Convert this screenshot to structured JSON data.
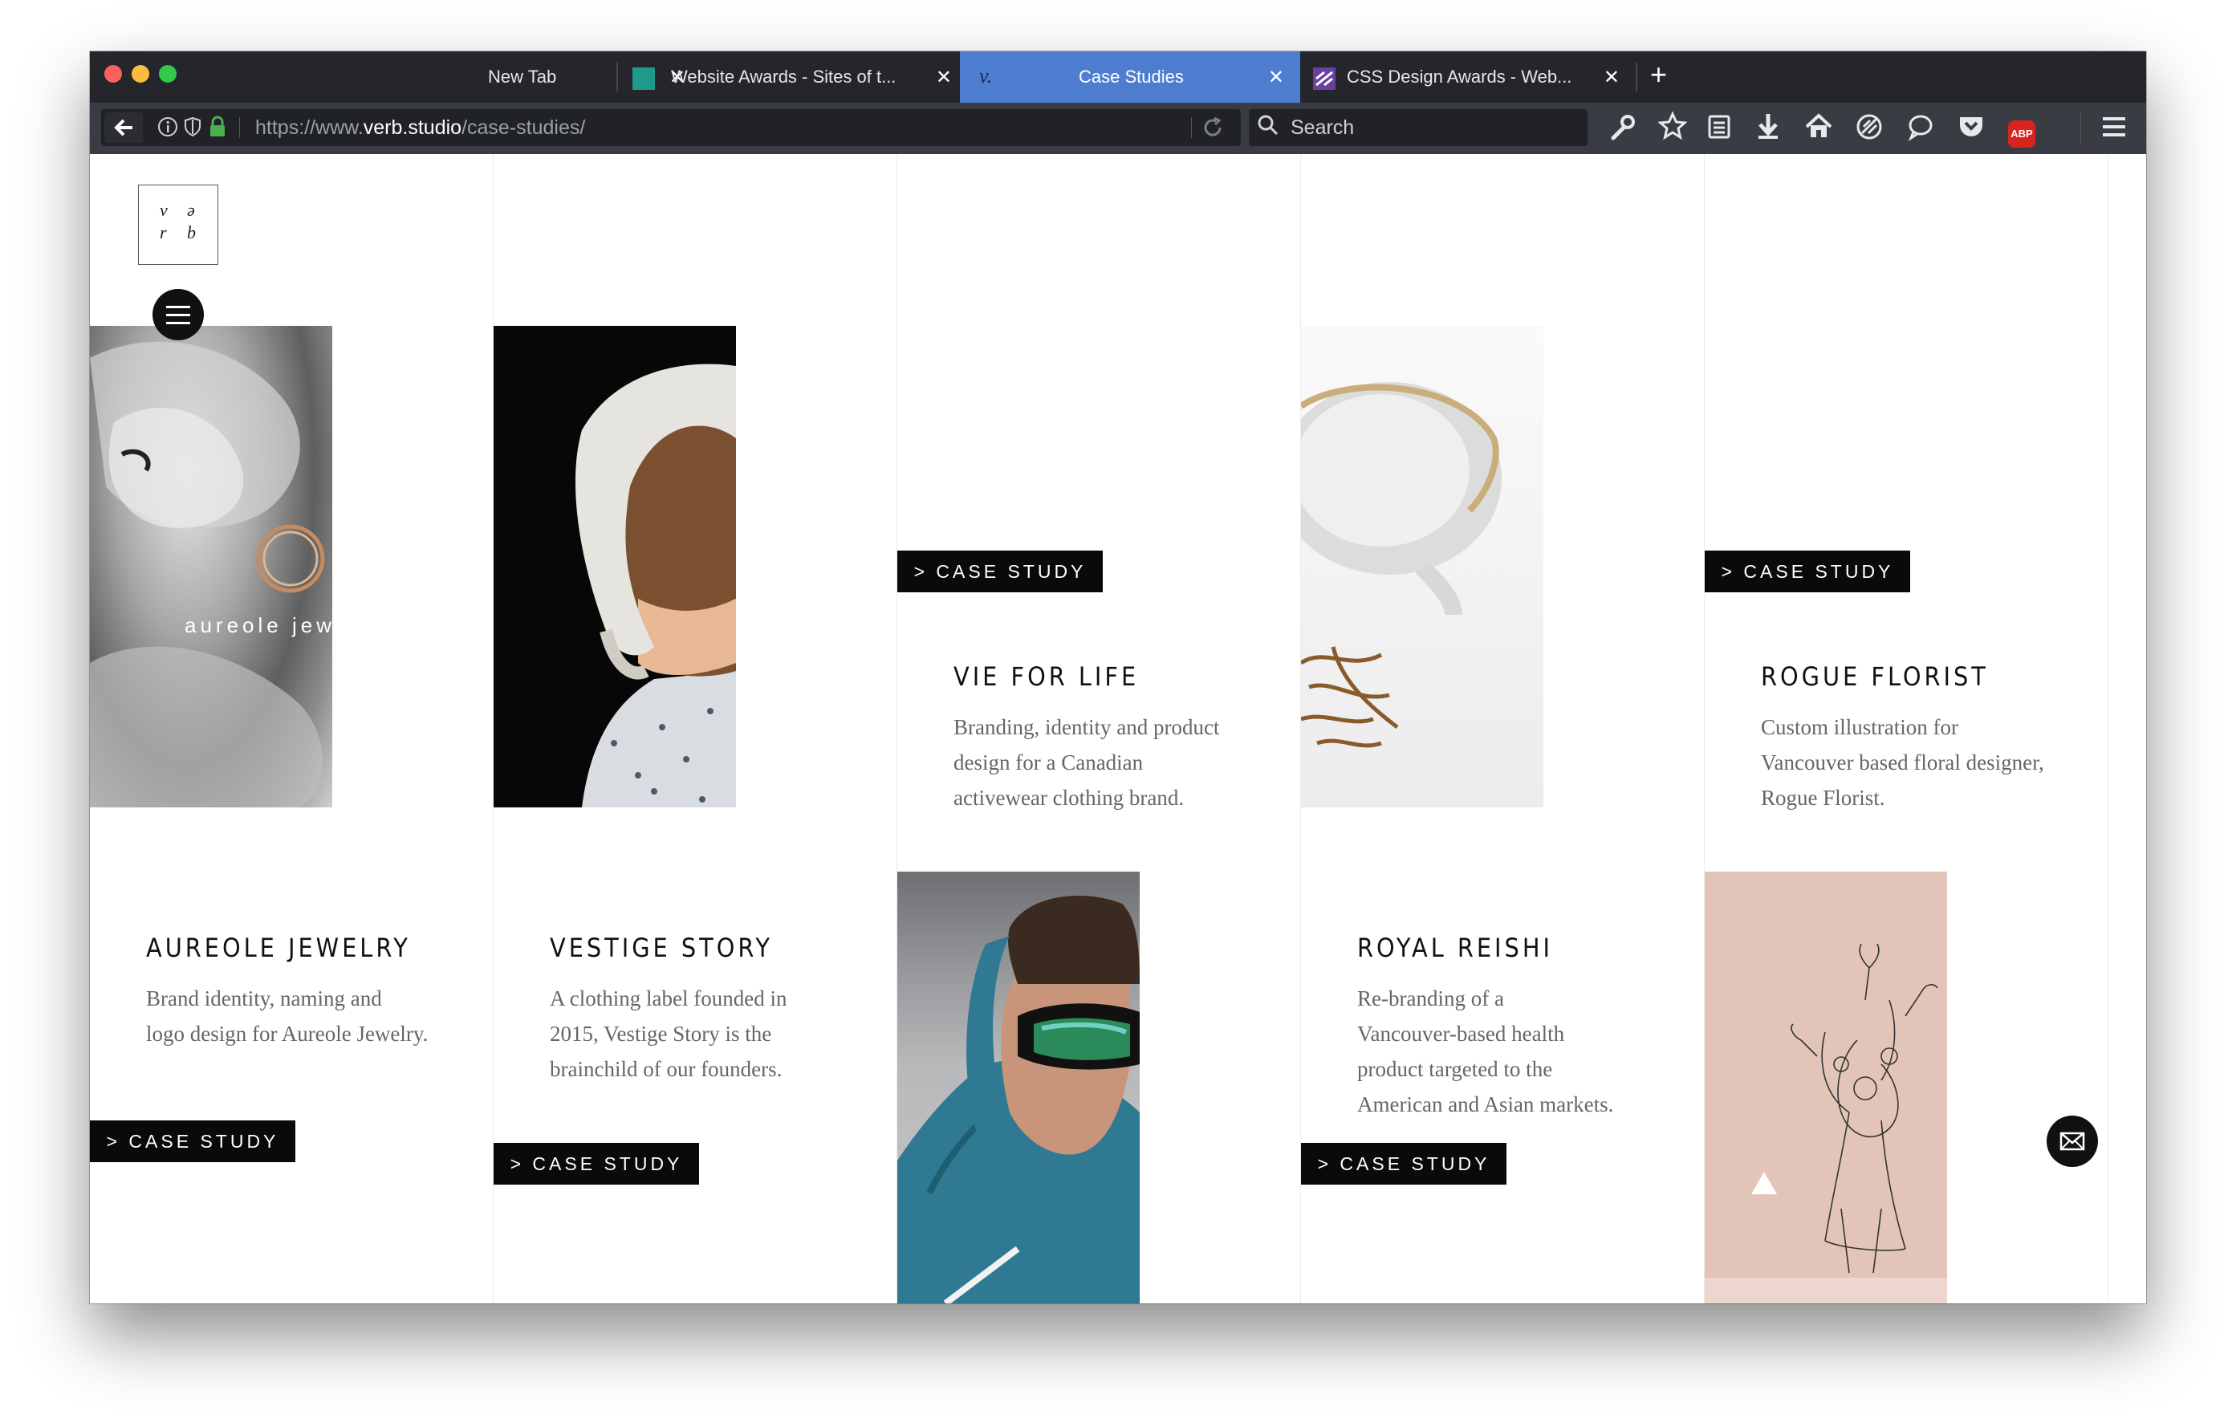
{
  "browser": {
    "tabs": [
      {
        "label": "New Tab",
        "close": "✕",
        "active": false
      },
      {
        "label": "Website Awards - Sites of t...",
        "close": "✕",
        "active": false
      },
      {
        "label": "Case Studies",
        "favicon_text": "v.",
        "close": "✕",
        "active": true
      },
      {
        "label": "CSS Design Awards - Web...",
        "close": "✕",
        "active": false
      }
    ],
    "new_tab": "+",
    "url_prefix": "https://www.",
    "url_domain": "verb.studio",
    "url_path": "/case-studies/",
    "search_placeholder": "Search",
    "abp_label": "ABP"
  },
  "site": {
    "logo_letters": [
      "v",
      "ə",
      "r",
      "b"
    ],
    "case_label": "> CASE STUDY",
    "aureole_overlay": "aureole jew"
  },
  "projects": [
    {
      "title": "AUREOLE JEWELRY",
      "desc": [
        "Brand identity, naming and",
        "logo design for Aureole Jewelry."
      ]
    },
    {
      "title": "VESTIGE STORY",
      "desc": [
        "A clothing label founded in",
        "2015, Vestige Story is the",
        "brainchild of our founders."
      ]
    },
    {
      "title": "VIE FOR LIFE",
      "desc": [
        "Branding, identity and product",
        "design for a Canadian",
        "activewear clothing brand."
      ]
    },
    {
      "title": "ROYAL REISHI",
      "desc": [
        "Re-branding of a",
        "Vancouver-based health",
        "product targeted to the",
        "American and Asian markets."
      ]
    },
    {
      "title": "ROGUE FLORIST",
      "desc": [
        "Custom illustration for",
        "Vancouver based floral designer,",
        "Rogue Florist."
      ]
    }
  ],
  "colors": {
    "accent_tab": "#4e7dd0",
    "tabbar": "#25262c",
    "navbar": "#3a3c44",
    "button_bg": "#0a0a0a",
    "text_gray": "#666666"
  }
}
